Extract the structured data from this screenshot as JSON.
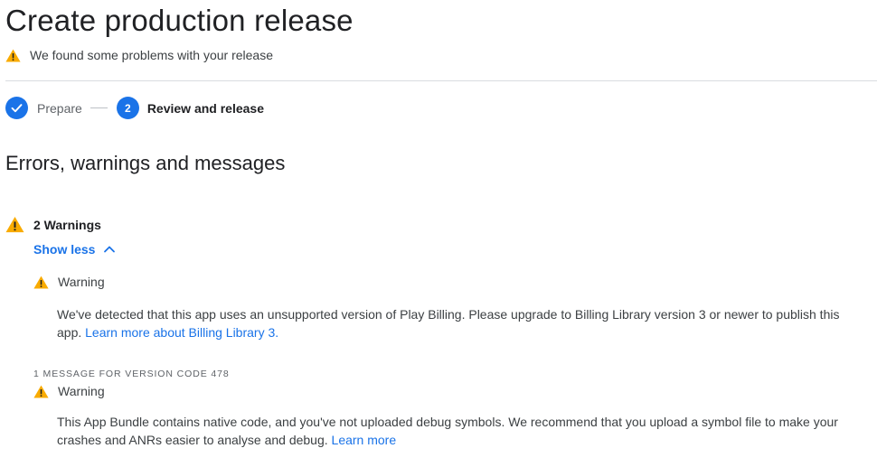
{
  "header": {
    "title": "Create production release",
    "status_text": "We found some problems with your release"
  },
  "stepper": {
    "steps": [
      {
        "label": "Prepare",
        "state": "done"
      },
      {
        "number": "2",
        "label": "Review and release",
        "state": "active"
      }
    ]
  },
  "section": {
    "title": "Errors, warnings and messages"
  },
  "warnings": {
    "count_label": "2 Warnings",
    "toggle_label": "Show less",
    "items": [
      {
        "heading": "Warning",
        "text": "We've detected that this app uses an unsupported version of Play Billing. Please upgrade to Billing Library version 3 or newer to publish this app. ",
        "link_text": "Learn more about Billing Library 3."
      },
      {
        "group_label": "1 MESSAGE FOR VERSION CODE 478",
        "heading": "Warning",
        "text": "This App Bundle contains native code, and you've not uploaded debug symbols. We recommend that you upload a symbol file to make your crashes and ANRs easier to analyse and debug. ",
        "link_text": "Learn more"
      }
    ]
  },
  "colors": {
    "accent": "#1a73e8",
    "warning": "#f9ab00",
    "text": "#202124",
    "muted": "#5f6368"
  },
  "icons": [
    "warning-icon",
    "check-icon",
    "chevron-up-icon"
  ]
}
